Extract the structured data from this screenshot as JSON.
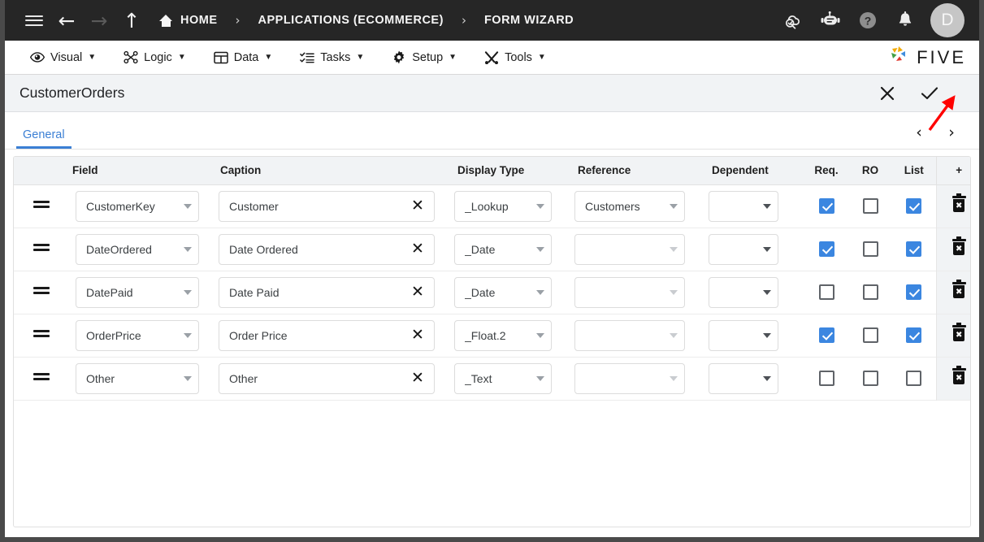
{
  "topbar": {
    "menu_icon": "hamburger-icon",
    "back_icon": "arrow-left-icon",
    "forward_icon": "arrow-right-icon",
    "up_icon": "arrow-up-icon",
    "breadcrumbs": [
      {
        "label": "HOME",
        "icon": "home-icon"
      },
      {
        "label": "APPLICATIONS (ECOMMERCE)",
        "icon": ""
      },
      {
        "label": "FORM WIZARD",
        "icon": ""
      }
    ],
    "separator": "›",
    "right_icons": [
      {
        "name": "cloud-check-icon",
        "glyph": ""
      },
      {
        "name": "chat-bot-icon",
        "glyph": ""
      },
      {
        "name": "help-icon",
        "glyph": "?"
      },
      {
        "name": "notifications-bell-icon",
        "glyph": ""
      }
    ],
    "avatar_initial": "D",
    "bg": "#262626"
  },
  "menubar": {
    "accent_color": "#f2a900",
    "items": [
      {
        "label": "Visual",
        "icon": "eye-icon",
        "caret": "▼"
      },
      {
        "label": "Logic",
        "icon": "logic-nodes-icon",
        "caret": "▼"
      },
      {
        "label": "Data",
        "icon": "table-grid-icon",
        "caret": "▼"
      },
      {
        "label": "Tasks",
        "icon": "checklist-icon",
        "caret": "▼"
      },
      {
        "label": "Setup",
        "icon": "gear-icon",
        "caret": "▼"
      },
      {
        "label": "Tools",
        "icon": "tools-icon",
        "caret": "▼"
      }
    ],
    "brand_text": "FIVE",
    "brand_icon": "five-logo-icon"
  },
  "page": {
    "title": "CustomerOrders",
    "close_label": "✕",
    "confirm_label": "✓"
  },
  "tabs": {
    "items": [
      {
        "label": "General",
        "active": true
      }
    ],
    "prev_label": "‹",
    "next_label": "›",
    "active_color": "#3b7fd4"
  },
  "grid": {
    "columns": [
      "",
      "Field",
      "Caption",
      "Display Type",
      "Reference",
      "Dependent",
      "Req.",
      "RO",
      "List",
      "+"
    ],
    "add_label": "+",
    "clear_label": "✕",
    "delete_icon": "trash-x-icon",
    "drag_icon": "drag-handle-icon",
    "checked_color": "#3b86e0",
    "rows": [
      {
        "field": "CustomerKey",
        "caption": "Customer",
        "display_type": "_Lookup",
        "reference": "Customers",
        "dependent": "",
        "req": true,
        "ro": false,
        "list": true
      },
      {
        "field": "DateOrdered",
        "caption": "Date Ordered",
        "display_type": "_Date",
        "reference": "",
        "dependent": "",
        "req": true,
        "ro": false,
        "list": true
      },
      {
        "field": "DatePaid",
        "caption": "Date Paid",
        "display_type": "_Date",
        "reference": "",
        "dependent": "",
        "req": false,
        "ro": false,
        "list": true
      },
      {
        "field": "OrderPrice",
        "caption": "Order Price",
        "display_type": "_Float.2",
        "reference": "",
        "dependent": "",
        "req": true,
        "ro": false,
        "list": true
      },
      {
        "field": "Other",
        "caption": "Other",
        "display_type": "_Text",
        "reference": "",
        "dependent": "",
        "req": false,
        "ro": false,
        "list": false
      }
    ]
  },
  "annotation": {
    "type": "arrow",
    "color": "#ff0000",
    "points_to": "confirm-check-button"
  }
}
